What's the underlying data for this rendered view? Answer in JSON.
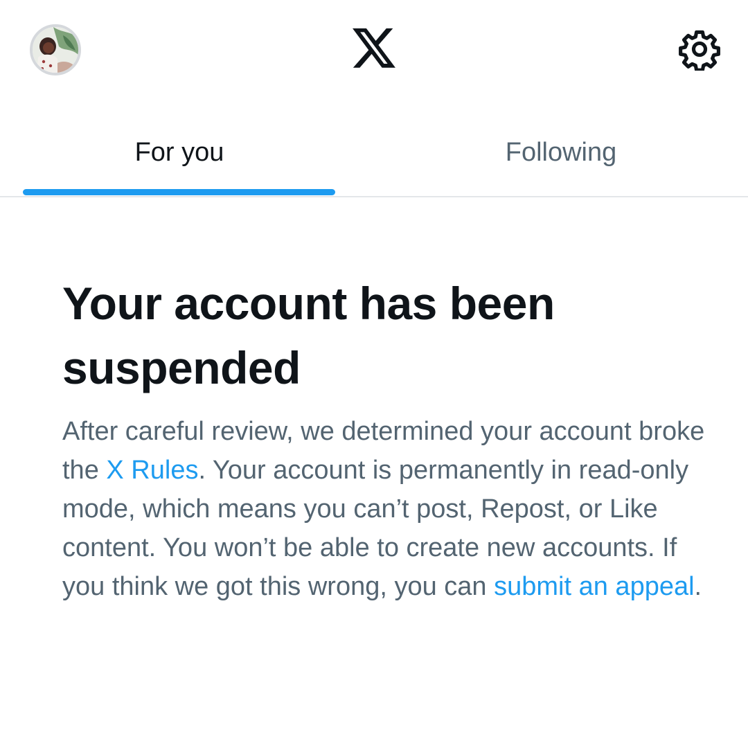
{
  "header": {
    "avatar_icon": "user-avatar",
    "logo_icon": "x-logo-icon",
    "settings_icon": "gear-icon"
  },
  "tabs": [
    {
      "label": "For you",
      "selected": true
    },
    {
      "label": "Following",
      "selected": false
    }
  ],
  "notice": {
    "title": "Your account has been suspended",
    "body_part1": "After careful review, we determined your account broke the ",
    "rules_link": "X Rules",
    "body_part2": ". Your account is permanently in read-only mode, which means you can’t post, Repost, or Like content. You won’t be able to create new accounts. If you think we got this wrong, you can ",
    "appeal_link": "submit an appeal",
    "body_end": "."
  },
  "colors": {
    "accent": "#1d9bf0",
    "text_primary": "#0f1419",
    "text_secondary": "#536471"
  }
}
